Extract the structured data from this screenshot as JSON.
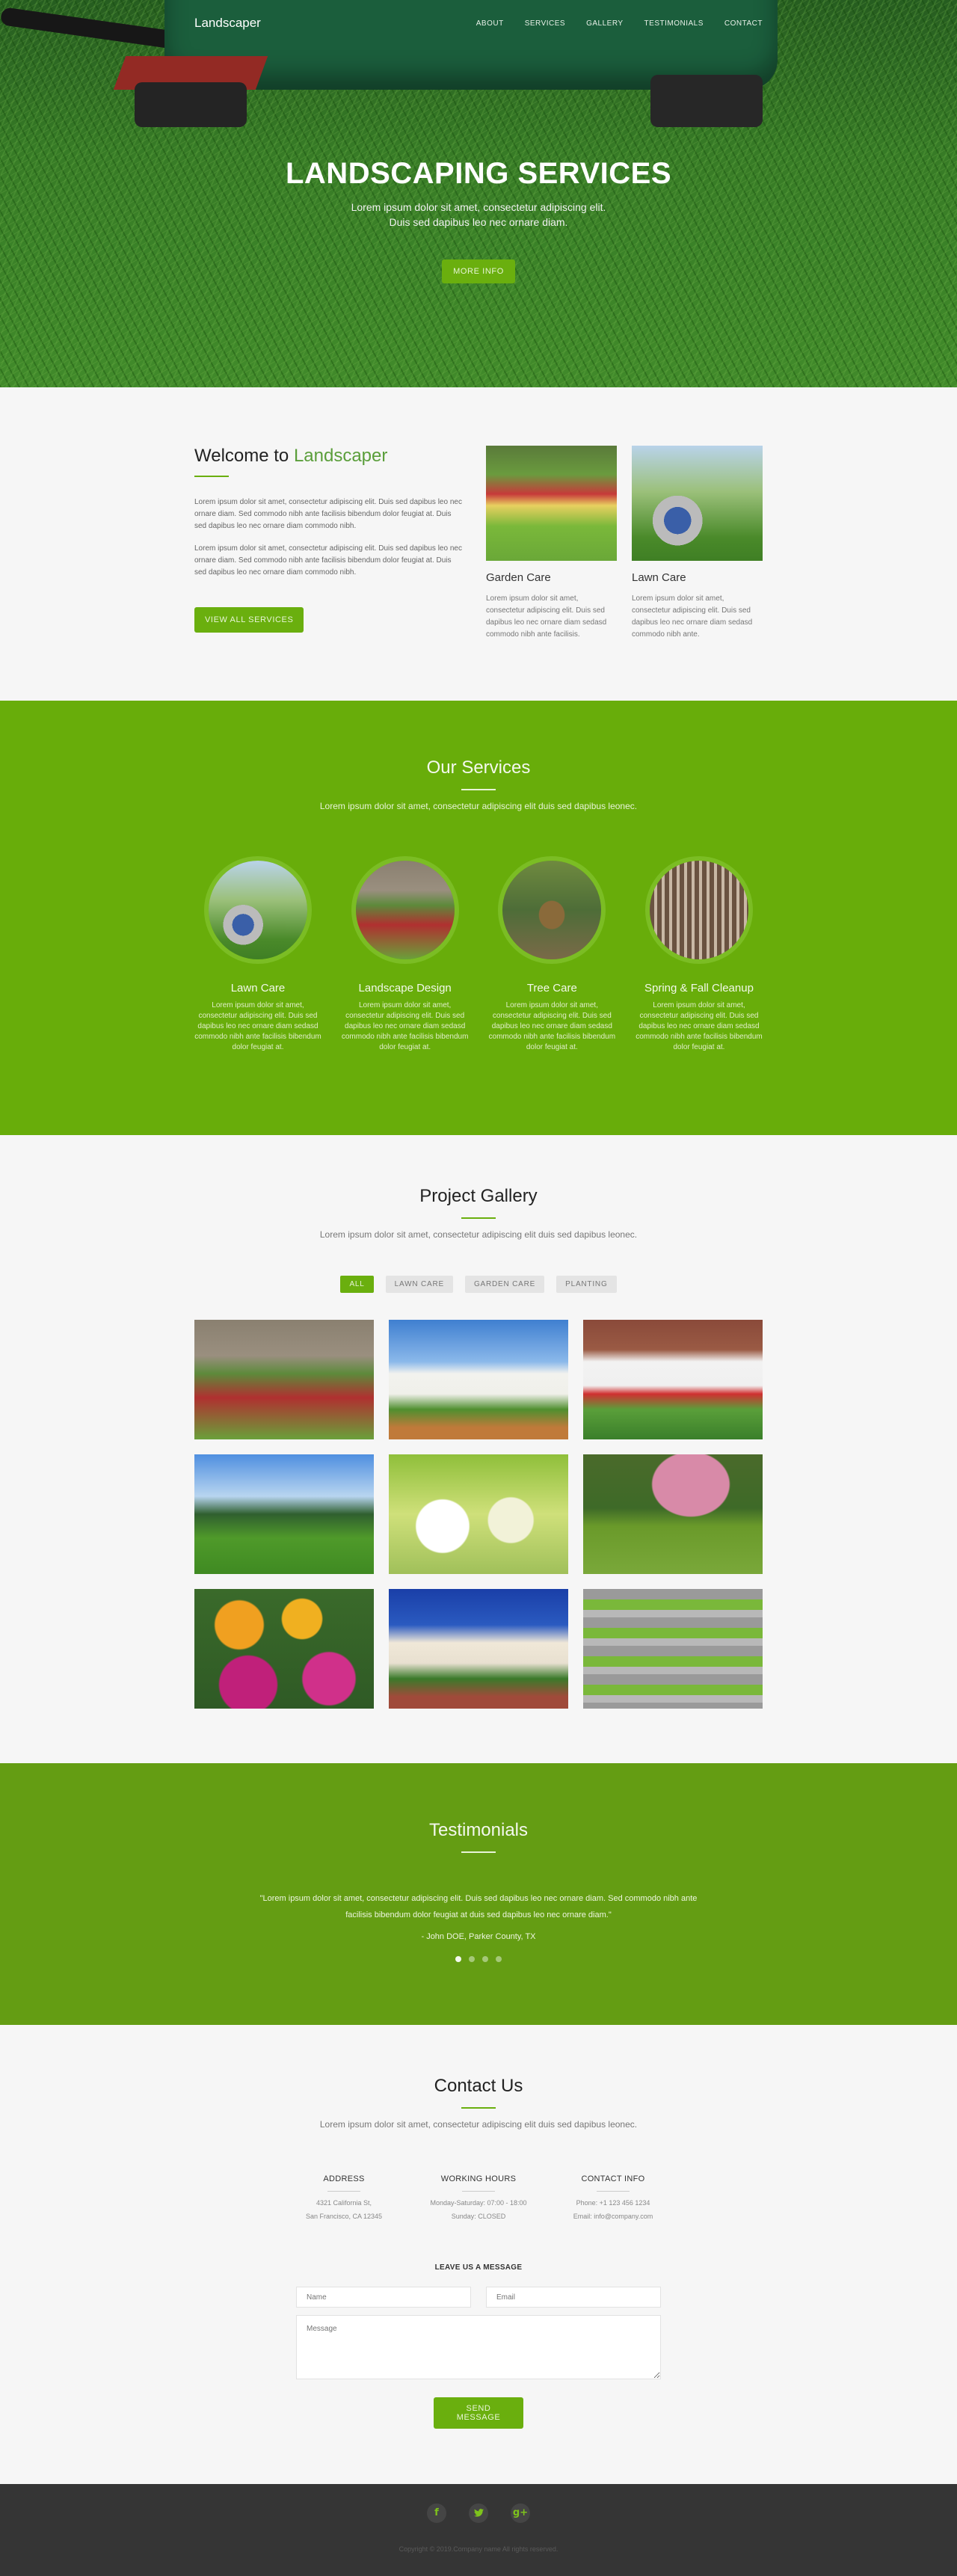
{
  "nav": {
    "brand": "Landscaper",
    "links": [
      "ABOUT",
      "SERVICES",
      "GALLERY",
      "TESTIMONIALS",
      "CONTACT"
    ]
  },
  "hero": {
    "title": "LANDSCAPING SERVICES",
    "subtitle_line1": "Lorem ipsum dolor sit amet, consectetur adipiscing elit.",
    "subtitle_line2": "Duis sed dapibus leo nec ornare diam.",
    "button": "MORE INFO"
  },
  "welcome": {
    "title_prefix": "Welcome to ",
    "title_accent": "Landscaper",
    "paragraphs": [
      "Lorem ipsum dolor sit amet, consectetur adipiscing elit. Duis sed dapibus leo nec ornare diam. Sed commodo nibh ante facilisis bibendum dolor feugiat at. Duis sed dapibus leo nec ornare diam commodo nibh.",
      "Lorem ipsum dolor sit amet, consectetur adipiscing elit. Duis sed dapibus leo nec ornare diam. Sed commodo nibh ante facilisis bibendum dolor feugiat at. Duis sed dapibus leo nec ornare diam commodo nibh."
    ],
    "button": "VIEW ALL SERVICES",
    "cards": [
      {
        "title": "Garden Care",
        "text": "Lorem ipsum dolor sit amet, consectetur adipiscing elit. Duis sed dapibus leo nec ornare diam sedasd commodo nibh ante facilisis."
      },
      {
        "title": "Lawn Care",
        "text": "Lorem ipsum dolor sit amet, consectetur adipiscing elit. Duis sed dapibus leo nec ornare diam sedasd commodo nibh ante."
      }
    ]
  },
  "services": {
    "title": "Our Services",
    "subtitle": "Lorem ipsum dolor sit amet, consectetur adipiscing elit duis sed dapibus leonec.",
    "items": [
      {
        "title": "Lawn Care",
        "text": "Lorem ipsum dolor sit amet, consectetur adipiscing elit. Duis sed dapibus leo nec ornare diam sedasd commodo nibh ante facilisis bibendum dolor feugiat at."
      },
      {
        "title": "Landscape Design",
        "text": "Lorem ipsum dolor sit amet, consectetur adipiscing elit. Duis sed dapibus leo nec ornare diam sedasd commodo nibh ante facilisis bibendum dolor feugiat at."
      },
      {
        "title": "Tree Care",
        "text": "Lorem ipsum dolor sit amet, consectetur adipiscing elit. Duis sed dapibus leo nec ornare diam sedasd commodo nibh ante facilisis bibendum dolor feugiat at."
      },
      {
        "title": "Spring & Fall Cleanup",
        "text": "Lorem ipsum dolor sit amet, consectetur adipiscing elit. Duis sed dapibus leo nec ornare diam sedasd commodo nibh ante facilisis bibendum dolor feugiat at."
      }
    ]
  },
  "gallery": {
    "title": "Project Gallery",
    "subtitle": "Lorem ipsum dolor sit amet, consectetur adipiscing elit duis sed dapibus leonec.",
    "filters": [
      "ALL",
      "LAWN CARE",
      "GARDEN CARE",
      "PLANTING"
    ],
    "active_filter": "ALL",
    "images": [
      "castle-garden",
      "white-mansion",
      "brick-window-flowers",
      "lawn-house",
      "chair-flowers",
      "patio-blossom-tree",
      "marigolds",
      "palm-house-stairs",
      "green-building"
    ]
  },
  "testimonials": {
    "title": "Testimonials",
    "quote": "\"Lorem ipsum dolor sit amet, consectetur adipiscing elit. Duis sed dapibus leo nec ornare diam. Sed commodo nibh ante facilisis bibendum dolor feugiat at duis sed dapibus leo nec ornare diam.\"",
    "author": "- John DOE, Parker County, TX",
    "slide_count": 4,
    "active_slide": 1
  },
  "contact": {
    "title": "Contact Us",
    "subtitle": "Lorem ipsum dolor sit amet, consectetur adipiscing elit duis sed dapibus leonec.",
    "address": {
      "title": "ADDRESS",
      "line1": "4321 California St,",
      "line2": "San Francisco, CA 12345"
    },
    "hours": {
      "title": "WORKING HOURS",
      "line1": "Monday-Saturday: 07:00 - 18:00",
      "line2": "Sunday: CLOSED"
    },
    "info": {
      "title": "CONTACT INFO",
      "line1": "Phone: +1 123 456 1234",
      "line2": "Email: info@company.com"
    },
    "form": {
      "title": "LEAVE US A MESSAGE",
      "name_placeholder": "Name",
      "email_placeholder": "Email",
      "message_placeholder": "Message",
      "button": "SEND MESSAGE"
    }
  },
  "footer": {
    "socials": [
      {
        "name": "facebook",
        "glyph": "f"
      },
      {
        "name": "twitter",
        "glyph": "t"
      },
      {
        "name": "google-plus",
        "glyph": "g+"
      }
    ],
    "copyright": "Copyright © 2019.Company name All rights reserved."
  },
  "colors": {
    "accent": "#6aaf0e",
    "services_bg": "#68ad0a",
    "testimonials_bg": "#649d13",
    "footer_bg": "#353535",
    "welcome_accent_text": "#5a9e3a"
  }
}
